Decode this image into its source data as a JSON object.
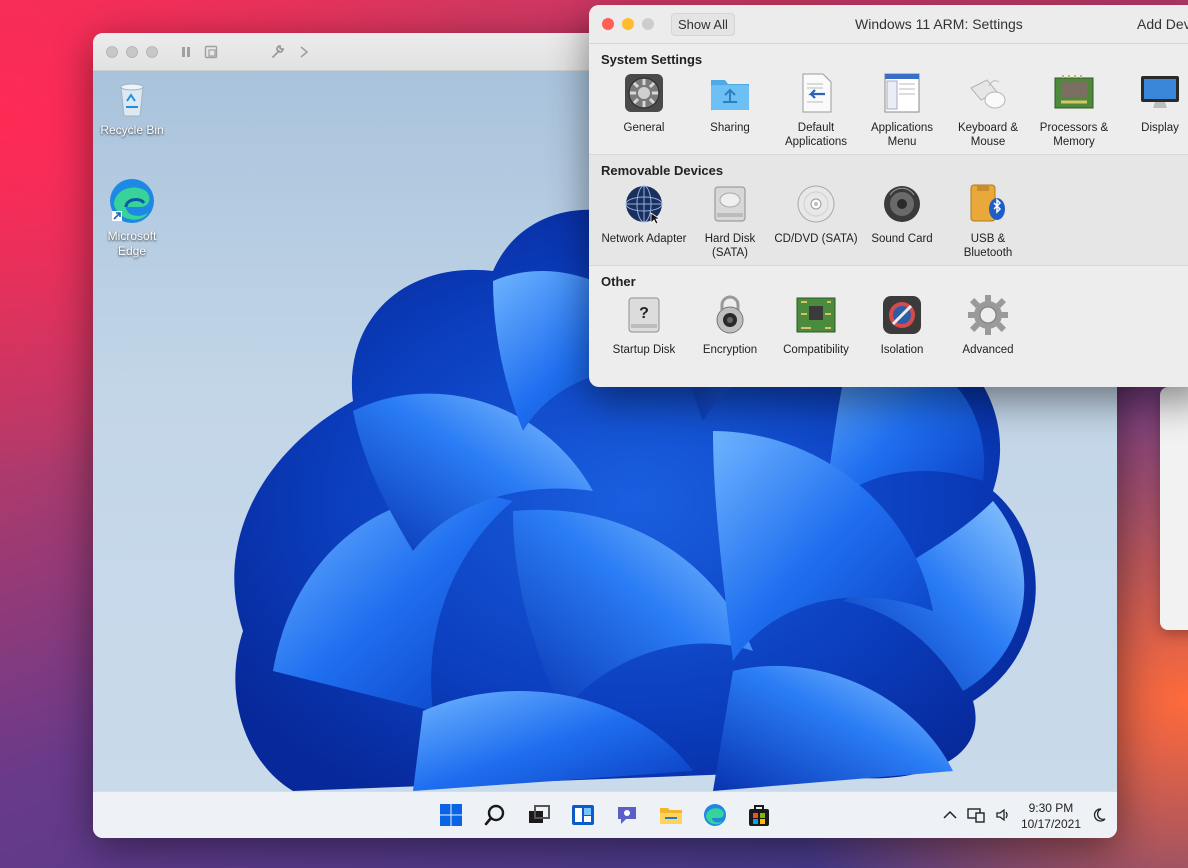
{
  "vm_window": {
    "title_tools": [
      "pause-icon",
      "snapshot-icon",
      "wrench-icon",
      "chevron-right-icon"
    ]
  },
  "desktop_icons": [
    {
      "label": "Recycle Bin",
      "icon": "recycle-bin-icon"
    },
    {
      "label": "Microsoft Edge",
      "icon": "edge-icon"
    }
  ],
  "taskbar": {
    "icons": [
      "windows-start-icon",
      "search-icon",
      "task-view-icon",
      "widgets-icon",
      "teams-chat-icon",
      "file-explorer-icon",
      "edge-icon",
      "store-icon"
    ],
    "time": "9:30 PM",
    "date": "10/17/2021"
  },
  "settings": {
    "show_all": "Show All",
    "title": "Windows 11 ARM: Settings",
    "add_device": "Add Dev",
    "sections": [
      {
        "title": "System Settings",
        "items": [
          {
            "label": "General",
            "icon": "general-icon"
          },
          {
            "label": "Sharing",
            "icon": "sharing-folder-icon"
          },
          {
            "label": "Default Applications",
            "icon": "default-applications-icon"
          },
          {
            "label": "Applications Menu",
            "icon": "applications-menu-icon"
          },
          {
            "label": "Keyboard & Mouse",
            "icon": "keyboard-mouse-icon"
          },
          {
            "label": "Processors & Memory",
            "icon": "processor-icon"
          },
          {
            "label": "Display",
            "icon": "display-icon"
          }
        ]
      },
      {
        "title": "Removable Devices",
        "items": [
          {
            "label": "Network Adapter",
            "icon": "network-globe-icon"
          },
          {
            "label": "Hard Disk (SATA)",
            "icon": "hard-disk-icon"
          },
          {
            "label": "CD/DVD (SATA)",
            "icon": "cd-dvd-icon"
          },
          {
            "label": "Sound Card",
            "icon": "speaker-icon"
          },
          {
            "label": "USB & Bluetooth",
            "icon": "usb-bluetooth-icon"
          }
        ]
      },
      {
        "title": "Other",
        "items": [
          {
            "label": "Startup Disk",
            "icon": "startup-disk-icon"
          },
          {
            "label": "Encryption",
            "icon": "lock-icon"
          },
          {
            "label": "Compatibility",
            "icon": "circuit-board-icon"
          },
          {
            "label": "Isolation",
            "icon": "isolation-icon"
          },
          {
            "label": "Advanced",
            "icon": "gear-icon"
          }
        ]
      }
    ]
  },
  "colors": {
    "close": "#ff5f57",
    "minimize": "#febc2e",
    "zoom_inactive": "#cdcdcd",
    "windows_blue": "#0a64e6"
  }
}
